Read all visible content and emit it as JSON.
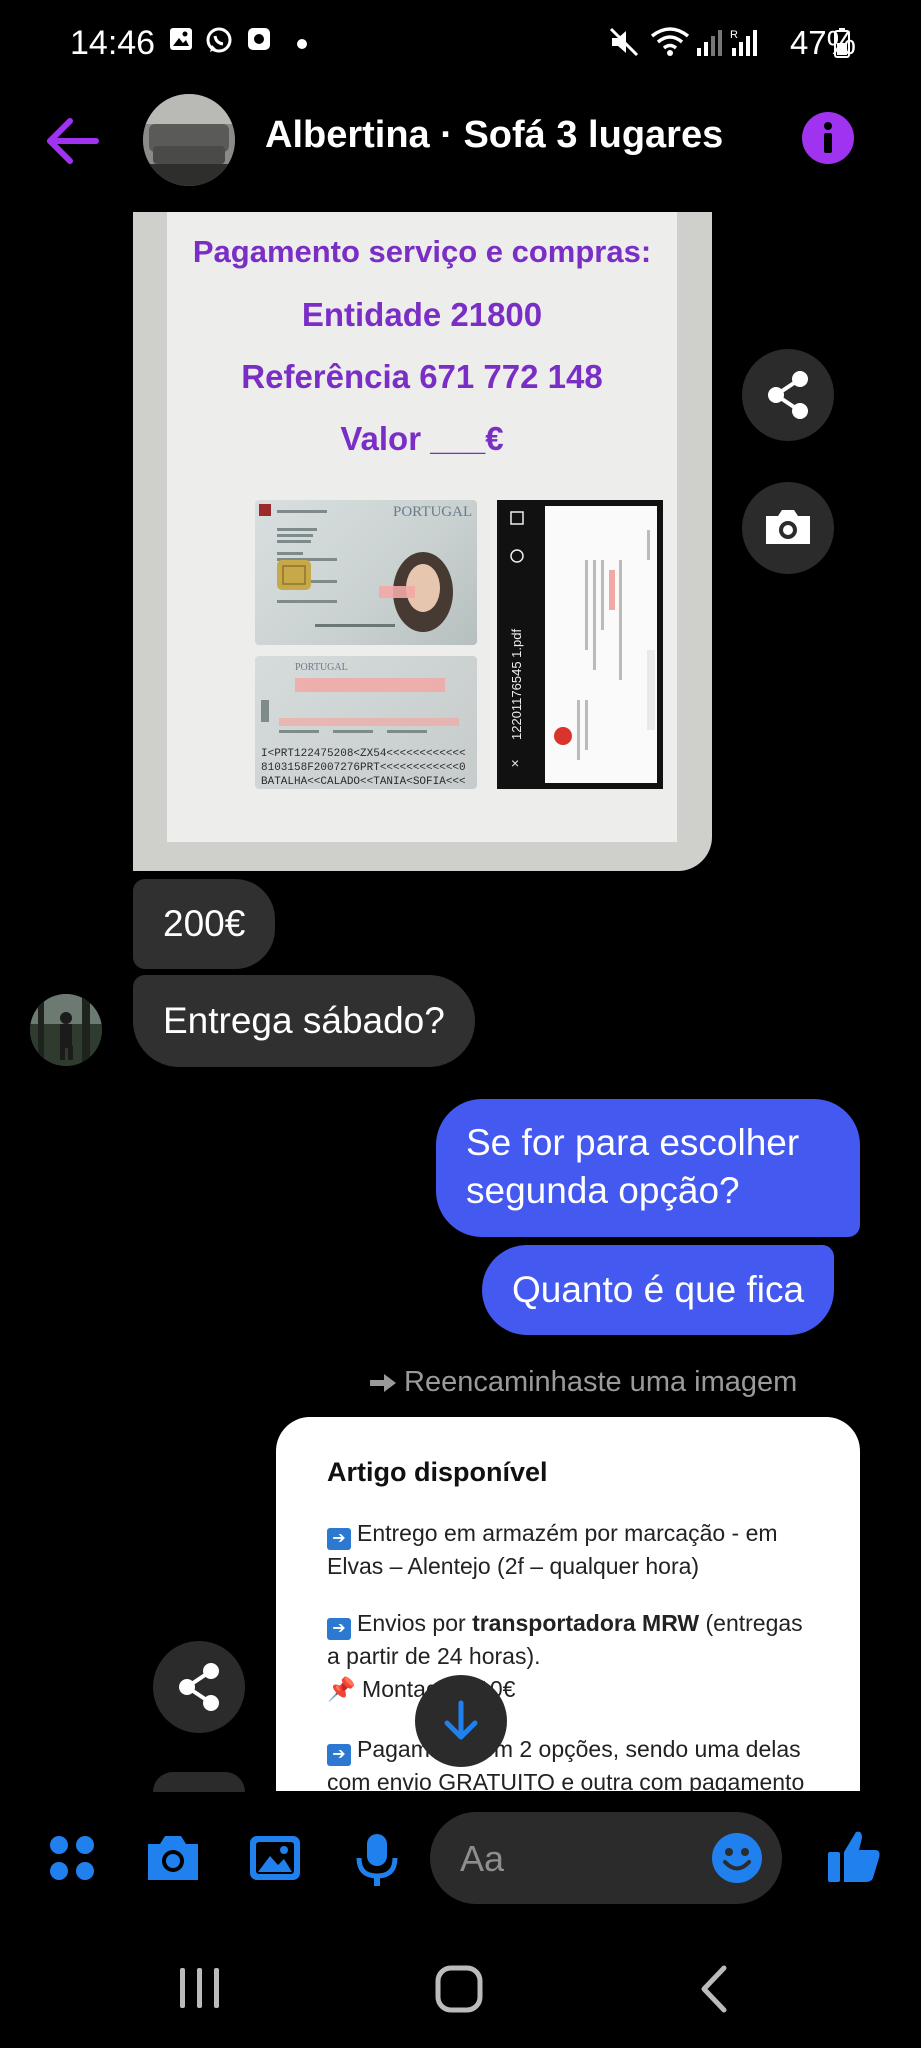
{
  "status_bar": {
    "time": "14:46",
    "battery": "47%"
  },
  "header": {
    "title": "Albertina · Sofá 3 lugares",
    "accent_color": "#a033f0"
  },
  "image_message_1": {
    "lines": [
      "Pagamento serviço e compras:",
      "Entidade 21800",
      "Referência 671 772 148",
      "Valor ___€"
    ],
    "id_card_country": "PORTUGAL",
    "mrz": [
      "I<PRT122475208<ZX54<<<<<<<<<<<<",
      "8103158F2007276PRT<<<<<<<<<<<<0",
      "BATALHA<<CALADO<<TANIA<SOFIA<<<"
    ],
    "pdf_filename": "12201176545 1.pdf"
  },
  "messages": [
    {
      "id": "msg-200",
      "direction": "in",
      "text": "200€"
    },
    {
      "id": "msg-entrega",
      "direction": "in",
      "text": "Entrega sábado?"
    },
    {
      "id": "msg-escolher",
      "direction": "out",
      "lines": [
        "Se for para escolher",
        "segunda opção?"
      ]
    },
    {
      "id": "msg-quanto",
      "direction": "out",
      "text": "Quanto é que fica"
    }
  ],
  "forward_note": "Reencaminhaste uma imagem",
  "image_message_2": {
    "title": "Artigo disponível",
    "para1": [
      "Entrego em armazém por marcação - em",
      "Elvas – Alentejo (2f – qualquer hora)"
    ],
    "para2_prefix": "Envios por ",
    "para2_bold": "transportadora MRW",
    "para2_suffix": " (entregas",
    "para2_line2": "a partir de 24 horas).",
    "para3": "Montagem 10€",
    "para4": [
      "Pagamento em 2 opções, sendo uma delas",
      "com envio GRATUITO e outra com pagamento"
    ]
  },
  "composer": {
    "placeholder": "Aa",
    "icon_color": "#1f80ee"
  }
}
